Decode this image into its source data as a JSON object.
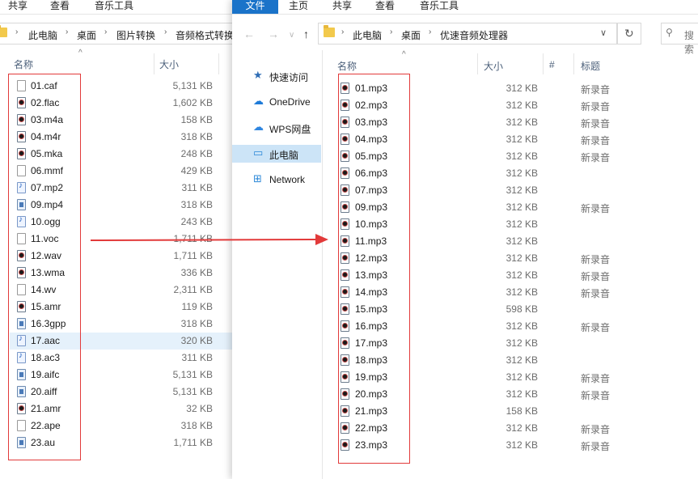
{
  "left_window": {
    "ribbon_tabs": [
      "共享",
      "查看",
      "音乐工具"
    ],
    "breadcrumb": [
      "此电脑",
      "桌面",
      "图片转换",
      "音频格式转换"
    ],
    "columns": {
      "name": "名称",
      "size": "大小"
    },
    "files": [
      {
        "name": "01.caf",
        "size": "5,131 KB",
        "icon": "blank-file-icon"
      },
      {
        "name": "02.flac",
        "size": "1,602 KB",
        "icon": "audio-file-icon"
      },
      {
        "name": "03.m4a",
        "size": "158 KB",
        "icon": "audio-file-icon"
      },
      {
        "name": "04.m4r",
        "size": "318 KB",
        "icon": "audio-file-icon"
      },
      {
        "name": "05.mka",
        "size": "248 KB",
        "icon": "audio-file-icon"
      },
      {
        "name": "06.mmf",
        "size": "429 KB",
        "icon": "blank-file-icon"
      },
      {
        "name": "07.mp2",
        "size": "311 KB",
        "icon": "music-note-icon"
      },
      {
        "name": "09.mp4",
        "size": "318 KB",
        "icon": "media-file-icon"
      },
      {
        "name": "10.ogg",
        "size": "243 KB",
        "icon": "music-note-icon"
      },
      {
        "name": "11.voc",
        "size": "1,711 KB",
        "icon": "blank-file-icon"
      },
      {
        "name": "12.wav",
        "size": "1,711 KB",
        "icon": "audio-file-icon"
      },
      {
        "name": "13.wma",
        "size": "336 KB",
        "icon": "audio-file-icon"
      },
      {
        "name": "14.wv",
        "size": "2,311 KB",
        "icon": "blank-file-icon"
      },
      {
        "name": "15.amr",
        "size": "119 KB",
        "icon": "audio-file-icon"
      },
      {
        "name": "16.3gpp",
        "size": "318 KB",
        "icon": "media-file-icon"
      },
      {
        "name": "17.aac",
        "size": "320 KB",
        "icon": "music-note-icon",
        "selected": true
      },
      {
        "name": "18.ac3",
        "size": "311 KB",
        "icon": "music-note-icon"
      },
      {
        "name": "19.aifc",
        "size": "5,131 KB",
        "icon": "media-file-icon"
      },
      {
        "name": "20.aiff",
        "size": "5,131 KB",
        "icon": "media-file-icon"
      },
      {
        "name": "21.amr",
        "size": "32 KB",
        "icon": "audio-file-icon"
      },
      {
        "name": "22.ape",
        "size": "318 KB",
        "icon": "blank-file-icon"
      },
      {
        "name": "23.au",
        "size": "1,711 KB",
        "icon": "media-file-icon"
      }
    ]
  },
  "right_window": {
    "ribbon_tabs": [
      "文件",
      "主页",
      "共享",
      "查看",
      "音乐工具"
    ],
    "breadcrumb": [
      "此电脑",
      "桌面",
      "优速音频处理器"
    ],
    "search_placeholder": "搜索",
    "nav_items": [
      {
        "label": "快速访问",
        "icon": "star-icon"
      },
      {
        "label": "OneDrive",
        "icon": "cloud-icon"
      },
      {
        "label": "WPS网盘",
        "icon": "cloud-drive-icon"
      },
      {
        "label": "此电脑",
        "icon": "computer-icon",
        "selected": true
      },
      {
        "label": "Network",
        "icon": "network-icon"
      }
    ],
    "columns": {
      "name": "名称",
      "size": "大小",
      "number": "#",
      "title": "标题"
    },
    "files": [
      {
        "name": "01.mp3",
        "size": "312 KB",
        "title": "新录音"
      },
      {
        "name": "02.mp3",
        "size": "312 KB",
        "title": "新录音"
      },
      {
        "name": "03.mp3",
        "size": "312 KB",
        "title": "新录音"
      },
      {
        "name": "04.mp3",
        "size": "312 KB",
        "title": "新录音"
      },
      {
        "name": "05.mp3",
        "size": "312 KB",
        "title": "新录音"
      },
      {
        "name": "06.mp3",
        "size": "312 KB",
        "title": ""
      },
      {
        "name": "07.mp3",
        "size": "312 KB",
        "title": ""
      },
      {
        "name": "09.mp3",
        "size": "312 KB",
        "title": "新录音"
      },
      {
        "name": "10.mp3",
        "size": "312 KB",
        "title": ""
      },
      {
        "name": "11.mp3",
        "size": "312 KB",
        "title": ""
      },
      {
        "name": "12.mp3",
        "size": "312 KB",
        "title": "新录音"
      },
      {
        "name": "13.mp3",
        "size": "312 KB",
        "title": "新录音"
      },
      {
        "name": "14.mp3",
        "size": "312 KB",
        "title": "新录音"
      },
      {
        "name": "15.mp3",
        "size": "598 KB",
        "title": ""
      },
      {
        "name": "16.mp3",
        "size": "312 KB",
        "title": "新录音"
      },
      {
        "name": "17.mp3",
        "size": "312 KB",
        "title": ""
      },
      {
        "name": "18.mp3",
        "size": "312 KB",
        "title": ""
      },
      {
        "name": "19.mp3",
        "size": "312 KB",
        "title": "新录音"
      },
      {
        "name": "20.mp3",
        "size": "312 KB",
        "title": "新录音"
      },
      {
        "name": "21.mp3",
        "size": "158 KB",
        "title": ""
      },
      {
        "name": "22.mp3",
        "size": "312 KB",
        "title": "新录音"
      },
      {
        "name": "23.mp3",
        "size": "312 KB",
        "title": "新录音"
      }
    ]
  },
  "colors": {
    "accent": "#1a73c9",
    "annotation_red": "#e23a3a",
    "selected_row": "#e5f1fb",
    "nav_selected": "#cce4f7"
  }
}
